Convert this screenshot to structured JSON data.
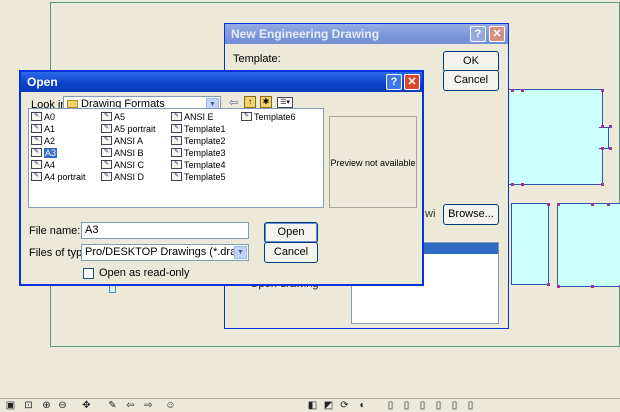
{
  "new_drawing_dialog": {
    "title": "New Engineering Drawing",
    "template_label": "Template:",
    "ok_label": "OK",
    "cancel_label": "Cancel",
    "browse_label": "Browse...",
    "partial_text": "wi",
    "partial_text_2": "Open drawing config"
  },
  "open_dialog": {
    "title": "Open",
    "look_in_label": "Look in:",
    "look_in_value": "Drawing Formats",
    "files": [
      {
        "name": "A0"
      },
      {
        "name": "A1"
      },
      {
        "name": "A2"
      },
      {
        "name": "A3",
        "selected": true
      },
      {
        "name": "A4"
      },
      {
        "name": "A4 portrait"
      },
      {
        "name": "A5"
      },
      {
        "name": "A5 portrait"
      },
      {
        "name": "ANSI A"
      },
      {
        "name": "ANSI B"
      },
      {
        "name": "ANSI C"
      },
      {
        "name": "ANSI D"
      },
      {
        "name": "ANSI E"
      },
      {
        "name": "Template1"
      },
      {
        "name": "Template2"
      },
      {
        "name": "Template3"
      },
      {
        "name": "Template4"
      },
      {
        "name": "Template5"
      },
      {
        "name": "Template6"
      }
    ],
    "preview_text": "Preview not available",
    "file_name_label": "File name:",
    "file_name_value": "A3",
    "files_of_type_label": "Files of type:",
    "files_of_type_value": "Pro/DESKTOP Drawings (*.dra)",
    "open_label": "Open",
    "cancel_label": "Cancel",
    "read_only_label": "Open as read-only",
    "read_only_checked": false
  },
  "colors": {
    "title_active": "#0a3fc9",
    "part_fill": "#ccffff",
    "selection": "#316ac5"
  },
  "icons": [
    "help-icon",
    "close-icon",
    "folder-icon",
    "back-icon",
    "up-folder-icon",
    "new-folder-icon",
    "views-menu-icon",
    "drawing-file-icon"
  ]
}
